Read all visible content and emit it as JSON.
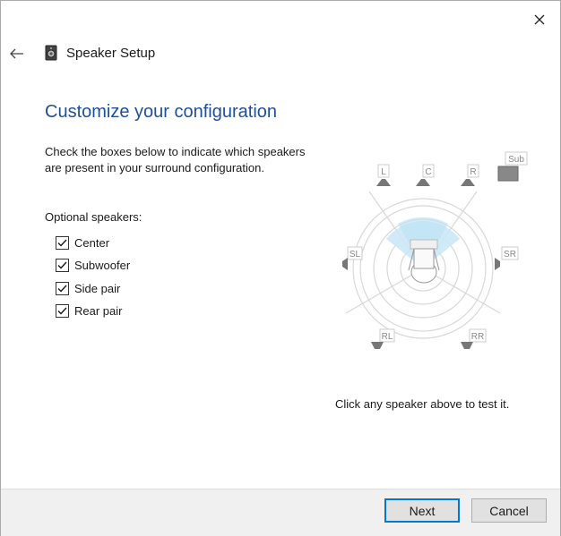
{
  "window": {
    "title": "Speaker Setup"
  },
  "page": {
    "heading": "Customize your configuration",
    "instructions": "Check the boxes below to indicate which speakers are present in your surround configuration.",
    "optional_label": "Optional speakers:",
    "checkboxes": [
      {
        "label": "Center",
        "checked": true
      },
      {
        "label": "Subwoofer",
        "checked": true
      },
      {
        "label": "Side pair",
        "checked": true
      },
      {
        "label": "Rear pair",
        "checked": true
      }
    ],
    "speakers": {
      "L": "L",
      "C": "C",
      "R": "R",
      "Sub": "Sub",
      "SL": "SL",
      "SR": "SR",
      "RL": "RL",
      "RR": "RR"
    },
    "test_hint": "Click any speaker above to test it."
  },
  "footer": {
    "next_label": "Next",
    "cancel_label": "Cancel"
  },
  "colors": {
    "heading": "#1f4f99",
    "accent": "#0078d7",
    "sound_field": "#cce8f7"
  },
  "icons": [
    "close-icon",
    "back-arrow-icon",
    "speaker-app-icon",
    "checkmark-icon",
    "speaker-icon",
    "subwoofer-icon",
    "listener-icon"
  ]
}
